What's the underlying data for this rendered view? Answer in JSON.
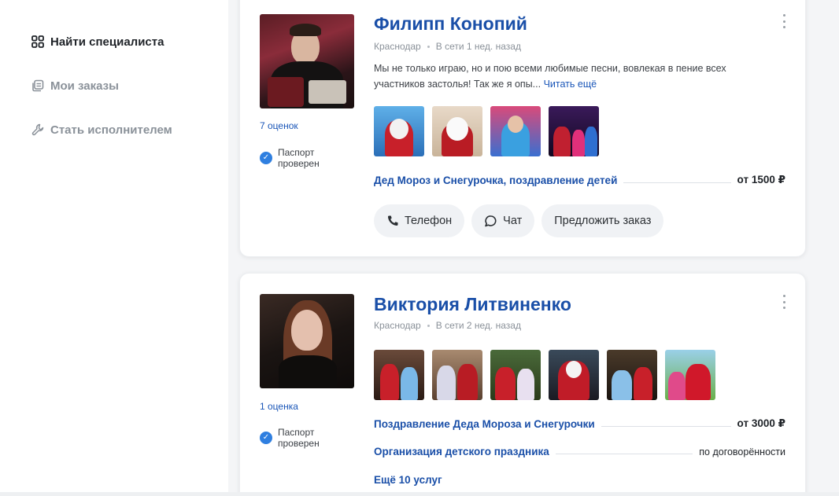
{
  "sidebar": {
    "items": [
      {
        "label": "Найти специалиста",
        "icon": "grid-icon",
        "active": true
      },
      {
        "label": "Мои заказы",
        "icon": "orders-icon",
        "active": false
      },
      {
        "label": "Стать исполнителем",
        "icon": "wrench-icon",
        "active": false
      }
    ]
  },
  "specialists": [
    {
      "name": "Филипп Конопий",
      "city": "Краснодар",
      "online": "В сети 1 нед. назад",
      "description": "Мы не только играю, но и пою всеми любимые песни, вовлекая в пение всех участников застолья! Так же я опы...",
      "read_more": "Читать ещё",
      "rating": "7 оценок",
      "passport": "Паспорт проверен",
      "services": [
        {
          "name": "Дед Мороз и Снегурочка, поздравление детей",
          "price": "от 1500 ₽"
        }
      ],
      "actions": {
        "phone": "Телефон",
        "chat": "Чат",
        "offer": "Предложить заказ"
      }
    },
    {
      "name": "Виктория Литвиненко",
      "city": "Краснодар",
      "online": "В сети 2 нед. назад",
      "rating": "1 оценка",
      "passport": "Паспорт проверен",
      "services": [
        {
          "name": "Поздравление Деда Мороза и Снегурочки",
          "price": "от 3000 ₽"
        },
        {
          "name": "Организация детского праздника",
          "price": "по договорённости"
        }
      ],
      "more_services": "Ещё 10 услуг"
    }
  ],
  "colors": {
    "accent": "#1a4fa8",
    "link": "#1a56b8",
    "badge": "#2f7fe0"
  }
}
